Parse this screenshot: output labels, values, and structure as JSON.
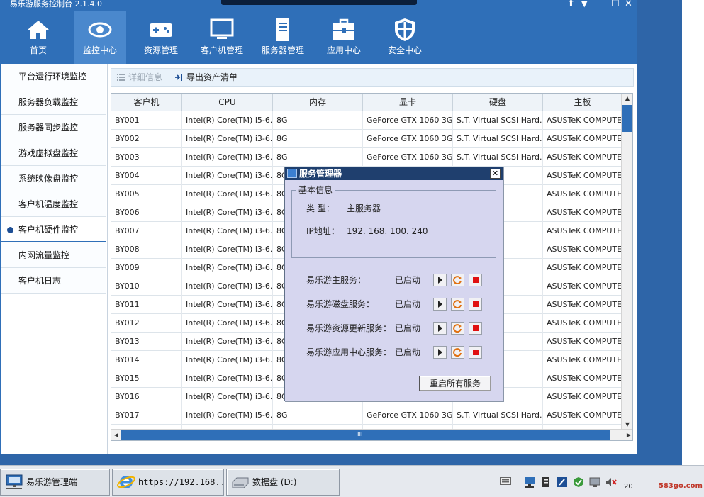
{
  "window": {
    "title": "易乐游服务控制台 2.1.4.0",
    "controls": [
      "⬆",
      "▼",
      "—",
      "☐",
      "✕"
    ]
  },
  "topnav": [
    {
      "label": "首页",
      "icon": "home-icon"
    },
    {
      "label": "监控中心",
      "icon": "eye-icon",
      "active": true
    },
    {
      "label": "资源管理",
      "icon": "gamepad-icon"
    },
    {
      "label": "客户机管理",
      "icon": "monitor-icon"
    },
    {
      "label": "服务器管理",
      "icon": "server-icon"
    },
    {
      "label": "应用中心",
      "icon": "toolbox-icon"
    },
    {
      "label": "安全中心",
      "icon": "shield-icon"
    }
  ],
  "sidebar": {
    "items": [
      {
        "label": "平台运行环境监控"
      },
      {
        "label": "服务器负载监控"
      },
      {
        "label": "服务器同步监控"
      },
      {
        "label": "游戏虚拟盘监控"
      },
      {
        "label": "系统映像盘监控"
      },
      {
        "label": "客户机温度监控"
      },
      {
        "label": "客户机硬件监控",
        "active": true
      },
      {
        "label": "内网流量监控"
      },
      {
        "label": "客户机日志"
      }
    ]
  },
  "toolbar": {
    "details_label": "详细信息",
    "export_label": "导出资产清单"
  },
  "grid": {
    "columns": [
      "客户机",
      "CPU",
      "内存",
      "显卡",
      "硬盘",
      "主板"
    ],
    "rows": [
      [
        "BY001",
        "Intel(R) Core(TM) i5-6...",
        "8G",
        "GeForce GTX 1060 3GB",
        "S.T. Virtual SCSI Hard...",
        "ASUSTeK COMPUTER I"
      ],
      [
        "BY002",
        "Intel(R) Core(TM) i3-6...",
        "8G",
        "GeForce GTX 1060 3GB",
        "S.T. Virtual SCSI Hard...",
        "ASUSTeK COMPUTER I"
      ],
      [
        "BY003",
        "Intel(R) Core(TM) i3-6...",
        "8G",
        "GeForce GTX 1060 3GB",
        "S.T. Virtual SCSI Hard...",
        "ASUSTeK COMPUTER I"
      ],
      [
        "BY004",
        "Intel(R) Core(TM) i3-6...",
        "8G",
        "",
        "SI Hard...",
        "ASUSTeK COMPUTER I"
      ],
      [
        "BY005",
        "Intel(R) Core(TM) i3-6...",
        "8G",
        "",
        "SI Hard...",
        "ASUSTeK COMPUTER I"
      ],
      [
        "BY006",
        "Intel(R) Core(TM) i3-6...",
        "8G",
        "",
        "SI Hard...",
        "ASUSTeK COMPUTER I"
      ],
      [
        "BY007",
        "Intel(R) Core(TM) i3-6...",
        "8G",
        "",
        "SI Hard...",
        "ASUSTeK COMPUTER I"
      ],
      [
        "BY008",
        "Intel(R) Core(TM) i3-6...",
        "8G",
        "",
        "SI Hard...",
        "ASUSTeK COMPUTER I"
      ],
      [
        "BY009",
        "Intel(R) Core(TM) i3-6...",
        "8G",
        "",
        "SI Hard...",
        "ASUSTeK COMPUTER I"
      ],
      [
        "BY010",
        "Intel(R) Core(TM) i3-6...",
        "8G",
        "",
        "SI Hard...",
        "ASUSTeK COMPUTER I"
      ],
      [
        "BY011",
        "Intel(R) Core(TM) i3-6...",
        "8G",
        "",
        "SI Hard...",
        "ASUSTeK COMPUTER I"
      ],
      [
        "BY012",
        "Intel(R) Core(TM) i3-6...",
        "8G",
        "",
        "SI Hard...",
        "ASUSTeK COMPUTER I"
      ],
      [
        "BY013",
        "Intel(R) Core(TM) i3-6...",
        "8G",
        "",
        "SI Hard...",
        "ASUSTeK COMPUTER I"
      ],
      [
        "BY014",
        "Intel(R) Core(TM) i3-6...",
        "8G",
        "",
        "SI Hard...",
        "ASUSTeK COMPUTER I"
      ],
      [
        "BY015",
        "Intel(R) Core(TM) i3-6...",
        "8G",
        "",
        "SI Hard...",
        "ASUSTeK COMPUTER I"
      ],
      [
        "BY016",
        "Intel(R) Core(TM) i3-6...",
        "8G",
        "",
        "SI Hard...",
        "ASUSTeK COMPUTER I"
      ],
      [
        "BY017",
        "Intel(R) Core(TM) i5-6...",
        "8G",
        "GeForce GTX 1060 3GB",
        "S.T. Virtual SCSI Hard...",
        "ASUSTeK COMPUTER I"
      ],
      [
        "BY018",
        "Intel(R) Core(TM) i3-6...",
        "8G",
        "GeForce GTX 1060 3GB",
        "S.T. Virtual SCSI Hard...",
        "ASUSTeK COMPUTER I"
      ]
    ],
    "hscroll_grip": "ııı"
  },
  "dialog": {
    "title": "服务管理器",
    "group_label": "基本信息",
    "type_label": "类  型：",
    "type_value": "主服务器",
    "ip_label": "IP地址：",
    "ip_value": "192. 168. 100. 240",
    "services": [
      {
        "name": "易乐游主服务：",
        "status": "已启动"
      },
      {
        "name": "易乐游磁盘服务：",
        "status": "已启动"
      },
      {
        "name": "易乐游资源更新服务：",
        "status": "已启动"
      },
      {
        "name": "易乐游应用中心服务：",
        "status": "已启动"
      }
    ],
    "restart_label": "重启所有服务",
    "close_glyph": "✕"
  },
  "taskbar": {
    "tasks": [
      {
        "label": "易乐游管理端",
        "icon": "network-icon"
      },
      {
        "label": "https://192.168....",
        "icon": "ie-icon"
      },
      {
        "label": "数据盘 (D:)",
        "icon": "drive-icon"
      }
    ],
    "clock_fragment": "20"
  },
  "watermark": "583go.com",
  "colors": {
    "nav_bg": "#2f6fb8",
    "nav_active": "#4a88cd",
    "dialog_bg": "#d6d6ef",
    "dialog_title": "#1f3f6e",
    "stop_red": "#e01010"
  }
}
